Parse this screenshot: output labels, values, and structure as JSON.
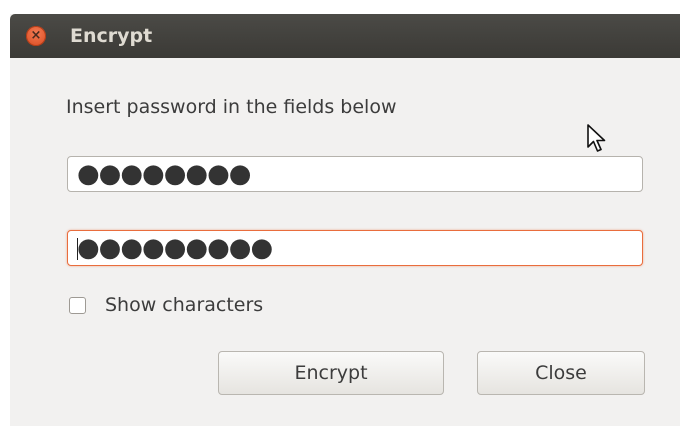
{
  "window": {
    "title": "Encrypt",
    "close_glyph": "×"
  },
  "form": {
    "prompt": "Insert password in the fields below",
    "password_field": {
      "value": "●●●●●●●●"
    },
    "confirm_field": {
      "value": "●●●●●●●●●"
    },
    "show_characters": {
      "label": "Show characters",
      "checked": false
    }
  },
  "buttons": {
    "encrypt": "Encrypt",
    "close": "Close"
  },
  "colors": {
    "titlebar": "#3c3b37",
    "focus_accent": "#e96d3d",
    "close_button": "#e8582e",
    "window_bg": "#f2f1f0"
  }
}
